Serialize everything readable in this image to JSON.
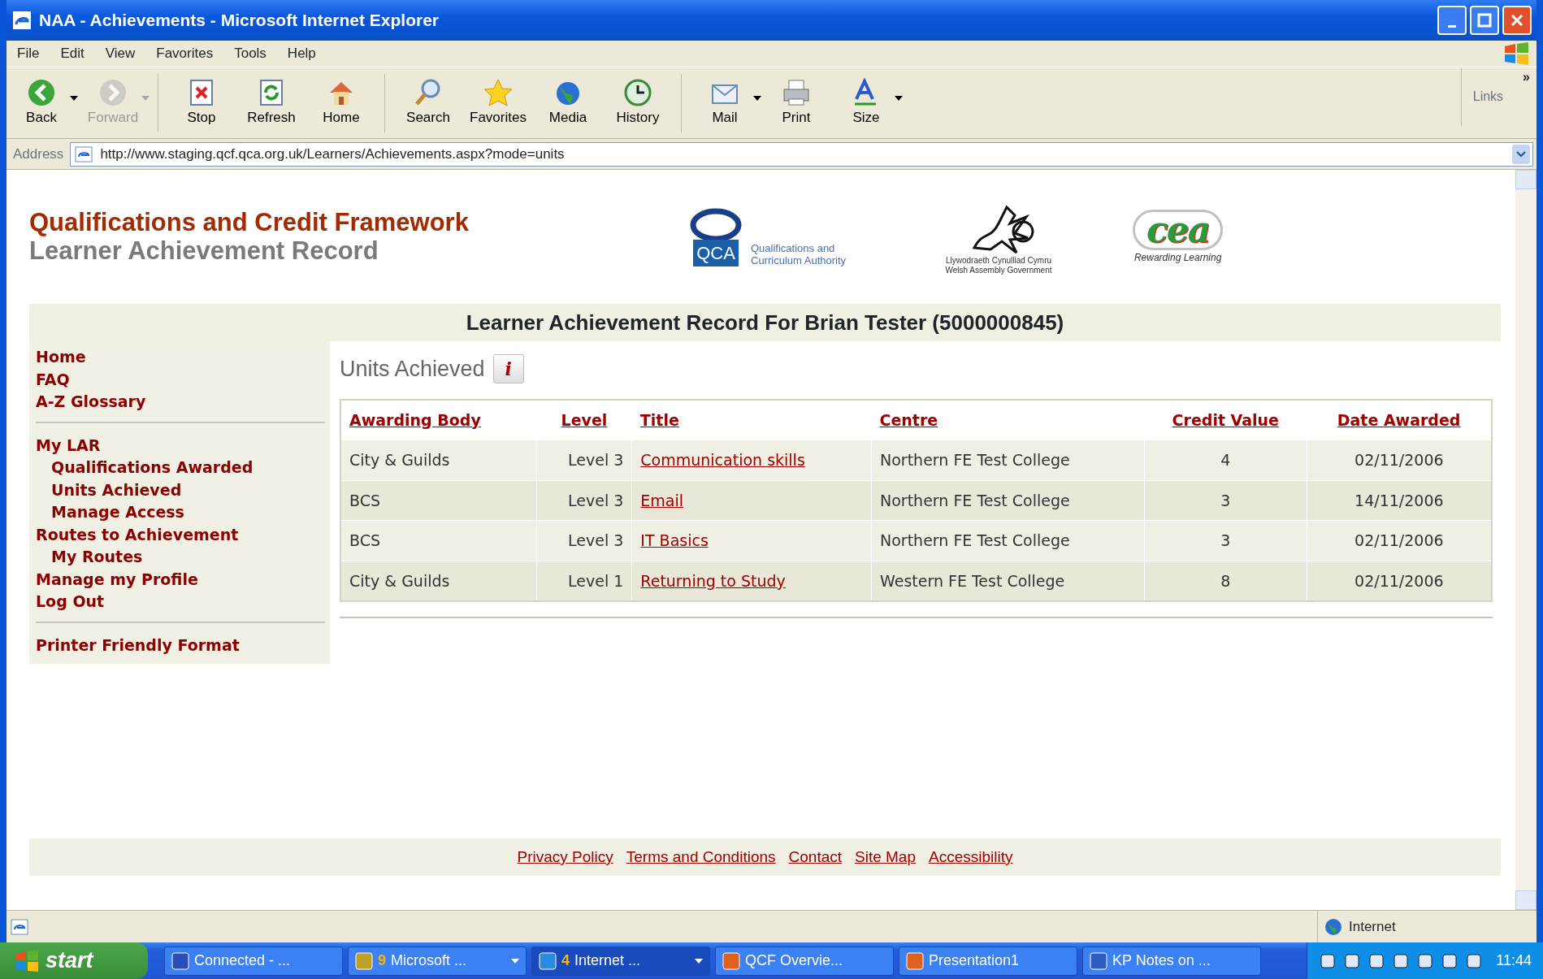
{
  "window": {
    "title": "NAA - Achievements - Microsoft Internet Explorer"
  },
  "menu": [
    "File",
    "Edit",
    "View",
    "Favorites",
    "Tools",
    "Help"
  ],
  "toolbar": [
    {
      "label": "Back",
      "disabled": false,
      "dropdown": true
    },
    {
      "label": "Forward",
      "disabled": true,
      "dropdown": true
    },
    {
      "label": "Stop",
      "disabled": false,
      "dropdown": false
    },
    {
      "label": "Refresh",
      "disabled": false,
      "dropdown": false
    },
    {
      "label": "Home",
      "disabled": false,
      "dropdown": false
    },
    {
      "label": "Search",
      "disabled": false,
      "dropdown": false
    },
    {
      "label": "Favorites",
      "disabled": false,
      "dropdown": false
    },
    {
      "label": "Media",
      "disabled": false,
      "dropdown": false
    },
    {
      "label": "History",
      "disabled": false,
      "dropdown": false
    },
    {
      "label": "Mail",
      "disabled": false,
      "dropdown": true
    },
    {
      "label": "Print",
      "disabled": false,
      "dropdown": false
    },
    {
      "label": "Size",
      "disabled": false,
      "dropdown": true
    }
  ],
  "links_label": "Links",
  "chevron": "»",
  "address": {
    "label": "Address",
    "value": "http://www.staging.qcf.qca.org.uk/Learners/Achievements.aspx?mode=units"
  },
  "site": {
    "title": "Qualifications and Credit Framework",
    "subtitle": "Learner Achievement Record",
    "logos": [
      {
        "mark": "QCA",
        "caption": "Qualifications and Curriculum Authority"
      },
      {
        "caption": "Llywodraeth Cynulliad Cymru Welsh Assembly Government"
      },
      {
        "mark": "cea",
        "caption": "Rewarding Learning"
      }
    ]
  },
  "record_heading": "Learner Achievement Record For Brian Tester (5000000845)",
  "sidebar": {
    "groups": [
      [
        {
          "label": "Home"
        },
        {
          "label": "FAQ"
        },
        {
          "label": "A-Z Glossary"
        }
      ],
      [
        {
          "label": "My LAR",
          "children": [
            {
              "label": "Qualifications Awarded"
            },
            {
              "label": "Units Achieved"
            },
            {
              "label": "Manage Access"
            }
          ]
        },
        {
          "label": "Routes to Achievement",
          "children": [
            {
              "label": "My Routes"
            }
          ]
        },
        {
          "label": "Manage my Profile"
        },
        {
          "label": "Log Out"
        }
      ],
      [
        {
          "label": "Printer Friendly Format"
        }
      ]
    ]
  },
  "main": {
    "heading": "Units Achieved",
    "info_icon": "i"
  },
  "table": {
    "columns": [
      "Awarding Body",
      "Level",
      "Title",
      "Centre",
      "Credit Value",
      "Date Awarded"
    ],
    "rows": [
      [
        "City & Guilds",
        "Level 3",
        "Communication skills",
        "Northern FE Test College",
        "4",
        "02/11/2006"
      ],
      [
        "BCS",
        "Level 3",
        "Email",
        "Northern FE Test College",
        "3",
        "14/11/2006"
      ],
      [
        "BCS",
        "Level 3",
        "IT Basics",
        "Northern FE Test College",
        "3",
        "02/11/2006"
      ],
      [
        "City & Guilds",
        "Level 1",
        "Returning to Study",
        "Western FE Test College",
        "8",
        "02/11/2006"
      ]
    ]
  },
  "footer_links": [
    "Privacy Policy",
    "Terms and Conditions",
    "Contact",
    "Site Map",
    "Accessibility"
  ],
  "status_bar": {
    "zone": "Internet"
  },
  "taskbar": {
    "start": "start",
    "clock": "11:44",
    "items": [
      {
        "label": "Connected - ...",
        "selected": false,
        "dropdown": false
      },
      {
        "count": "9",
        "label": "Microsoft ...",
        "selected": false,
        "dropdown": true
      },
      {
        "count": "4",
        "label": "Internet ...",
        "selected": true,
        "dropdown": true
      },
      {
        "label": "QCF Overvie...",
        "selected": false,
        "dropdown": false
      },
      {
        "label": "Presentation1",
        "selected": false,
        "dropdown": false
      },
      {
        "label": "KP Notes on ...",
        "selected": false,
        "dropdown": false
      }
    ]
  }
}
